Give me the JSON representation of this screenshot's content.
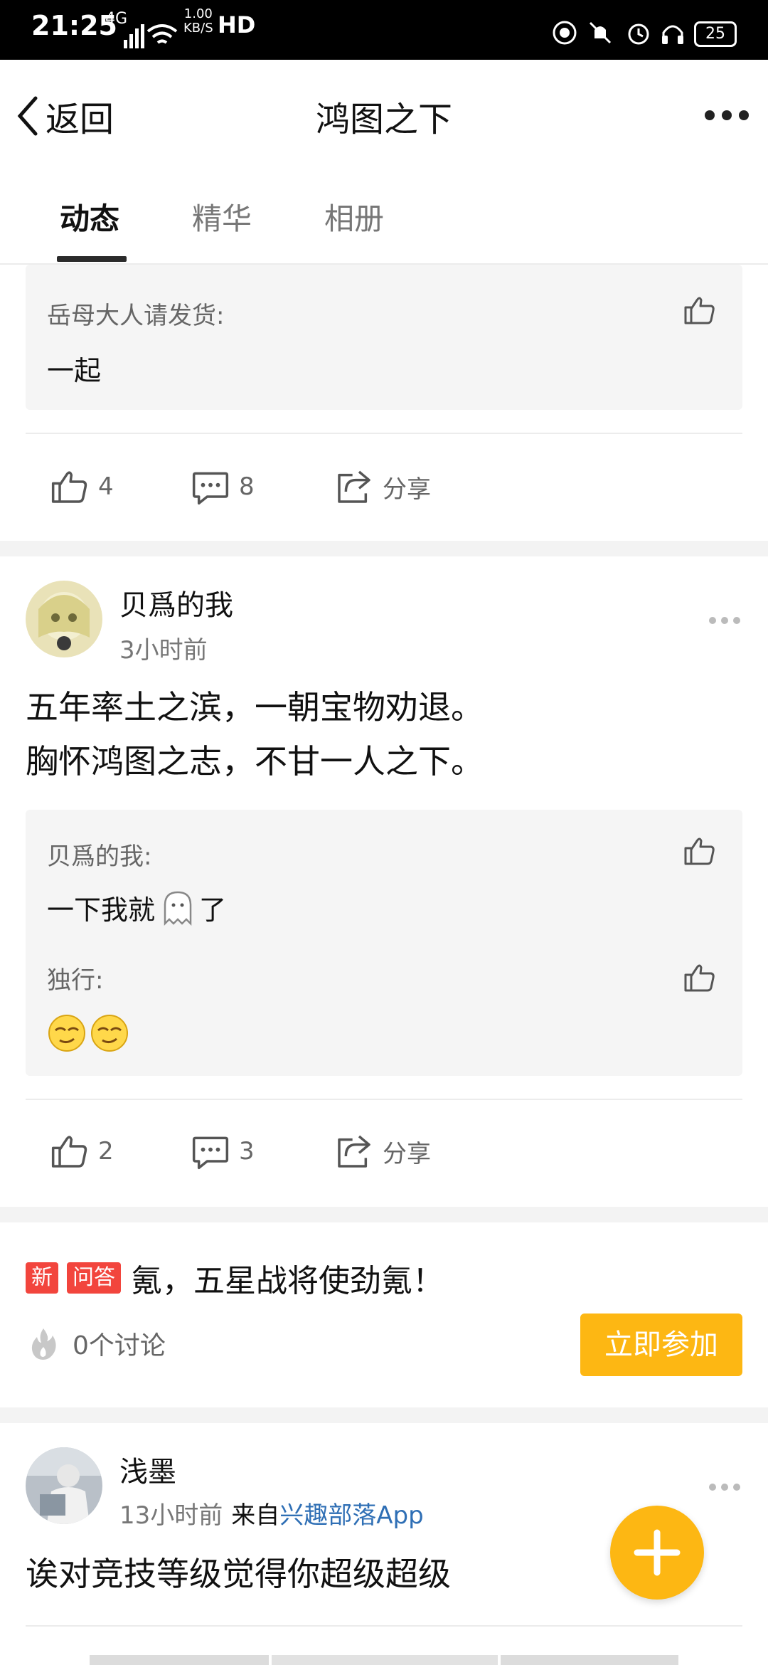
{
  "status_bar": {
    "time": "21:25",
    "network": "4G",
    "speed_value": "1.00",
    "speed_unit": "KB/S",
    "hd": "HD",
    "battery": "25"
  },
  "header": {
    "back_label": "返回",
    "title": "鸿图之下"
  },
  "tabs": [
    {
      "label": "动态",
      "active": true
    },
    {
      "label": "精华",
      "active": false
    },
    {
      "label": "相册",
      "active": false
    }
  ],
  "post1": {
    "comments": [
      {
        "name": "岳母大人请发货:",
        "text": "一起"
      }
    ],
    "likes": "4",
    "comments_count": "8",
    "share_label": "分享"
  },
  "post2": {
    "author": "贝爲的我",
    "time": "3小时前",
    "content_line1": "五年率土之滨，一朝宝物劝退。",
    "content_line2": "胸怀鸿图之志，不甘一人之下。",
    "comments": [
      {
        "name": "贝爲的我:",
        "text": "一下我就",
        "text_after": "了"
      },
      {
        "name": "独行:"
      }
    ],
    "likes": "2",
    "comments_count": "3",
    "share_label": "分享"
  },
  "qa": {
    "tag_new": "新",
    "tag_qa": "问答",
    "title": "氪，五星战将使劲氪！",
    "discussions": "0个讨论",
    "join_label": "立即参加"
  },
  "post3": {
    "author": "浅墨",
    "time": "13小时前",
    "from_prefix": "来自",
    "from_app": "兴趣部落App",
    "content": "诶对竞技等级觉得你超级超级"
  },
  "colors": {
    "accent": "#fdb713",
    "tag_red": "#f2453d",
    "link_blue": "#2f6fb5"
  }
}
